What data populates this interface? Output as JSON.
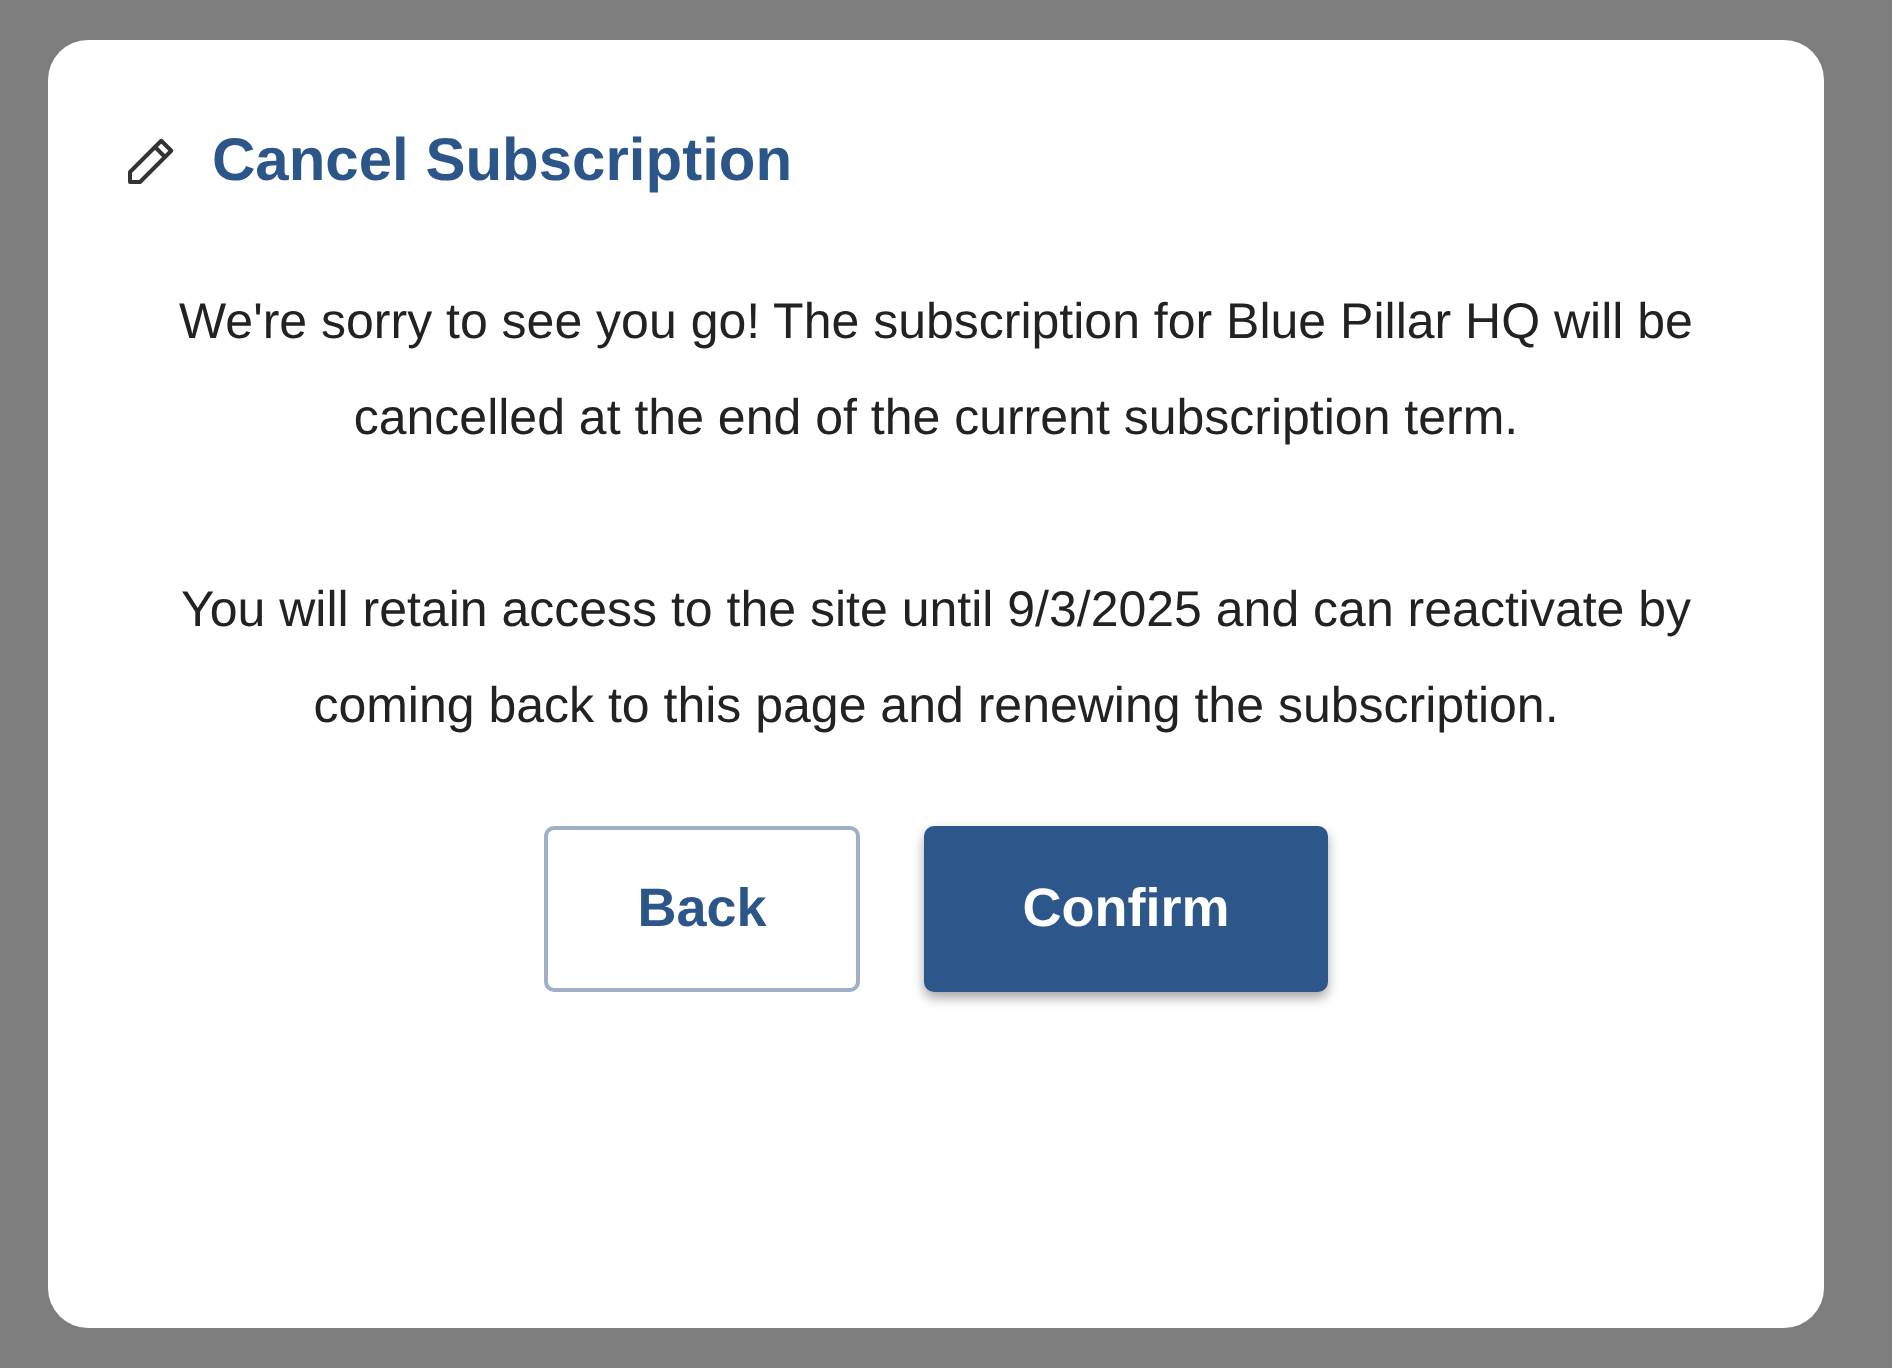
{
  "dialog": {
    "title": "Cancel Subscription",
    "paragraphs": [
      "We're sorry to see you go! The subscription for Blue Pillar HQ will be cancelled at the end of the current subscription term.",
      "You will retain access to the site until 9/3/2025 and can reactivate by coming back to this page and renewing the subscription."
    ],
    "buttons": [
      {
        "label": "Back",
        "kind": "secondary"
      },
      {
        "label": "Confirm",
        "kind": "primary"
      }
    ]
  }
}
